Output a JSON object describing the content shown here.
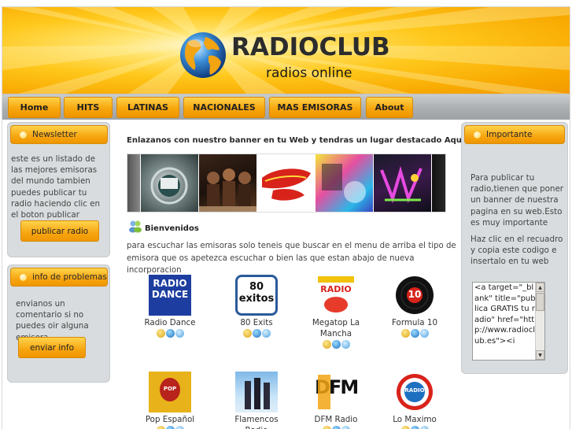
{
  "header": {
    "title": "RADIOCLUB",
    "subtitle": "radios online"
  },
  "nav": {
    "items": [
      {
        "label": "Home"
      },
      {
        "label": "HITS"
      },
      {
        "label": "LATINAS"
      },
      {
        "label": "NACIONALES"
      },
      {
        "label": "MAS EMISORAS"
      },
      {
        "label": "About"
      }
    ]
  },
  "left_sidebar": {
    "newsletter": {
      "heading": "Newsletter",
      "text": "este es un listado de las mejores emisoras del mundo tambien puedes publicar tu radio haciendo clic en el boton publicar",
      "button": "publicar radio"
    },
    "problems": {
      "heading": "info de problemas",
      "text": "envianos un comentario si no puedes oir alguna emisora",
      "button": "enviar info"
    }
  },
  "main": {
    "promo_text": "Enlazanos con nuestro banner en tu Web y tendras un lugar destacado Aqui",
    "welcome_heading": "Bienvenidos",
    "intro_text": "para escuchar las emisoras solo teneis que buscar en el menu de arriba el tipo de emisora que os apetezca escuchar o bien las que estan abajo de nueva incorporacion",
    "radios": [
      {
        "name": "Radio Dance",
        "logo_text": "RADIO DANCE"
      },
      {
        "name": "80 Exits",
        "logo_text": "80 exitos"
      },
      {
        "name": "Megatop La Mancha",
        "logo_text": "RADIO"
      },
      {
        "name": "Formula 10",
        "logo_text": "10"
      },
      {
        "name": "Pop Español",
        "logo_text": "POP ESPAÑOL"
      },
      {
        "name": "Flamencos Radio",
        "logo_text": ""
      },
      {
        "name": "DFM Radio",
        "logo_text": "DFM"
      },
      {
        "name": "Lo Maximo",
        "logo_text": "RADIO"
      }
    ]
  },
  "right_sidebar": {
    "heading": "Importante",
    "paragraph1": "Para publicar tu radio,tienen que poner un banner de nuestra pagina en su web.Esto es muy importante",
    "paragraph2": "Haz clic en el recuadro y copia este codigo e insertalo en tu web",
    "code_snippet": "<a target=\"_blank\" title=\"publica GRATIS tu radio\" href=\"http://www.radioclub.es\"><i"
  },
  "colors": {
    "accent_orange": "#f7a510",
    "header_yellow": "#ffc81c",
    "panel_grey": "#d8dcde"
  },
  "icons": {
    "player_icons": [
      "winamp-icon",
      "realplayer-icon",
      "quicktime-icon"
    ]
  }
}
